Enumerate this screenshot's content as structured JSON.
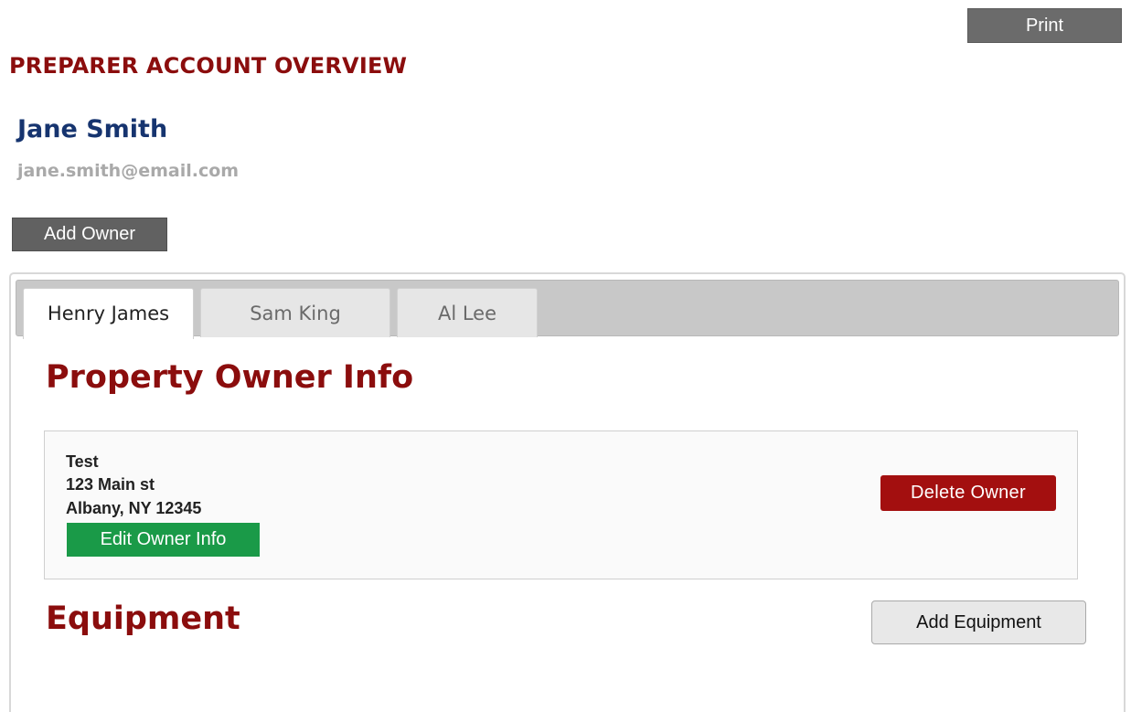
{
  "toolbar": {
    "print_label": "Print"
  },
  "page": {
    "title": "PREPARER ACCOUNT OVERVIEW"
  },
  "preparer": {
    "name": "Jane Smith",
    "email": "jane.smith@email.com"
  },
  "actions": {
    "add_owner_label": "Add Owner"
  },
  "tabs": [
    {
      "label": "Henry James",
      "active": true
    },
    {
      "label": "Sam King",
      "active": false
    },
    {
      "label": "Al Lee",
      "active": false
    }
  ],
  "owner_section": {
    "title": "Property Owner Info",
    "owner_name": "Test",
    "address_line1": "123 Main st",
    "address_line2": "Albany, NY 12345",
    "edit_label": "Edit Owner Info",
    "delete_label": "Delete Owner"
  },
  "equipment_section": {
    "title": "Equipment",
    "add_label": "Add Equipment"
  },
  "colors": {
    "heading_red": "#8b0d0d",
    "name_blue": "#16346f",
    "edit_green": "#1a9a48",
    "delete_red": "#a30f0f",
    "dark_button": "#616161"
  }
}
